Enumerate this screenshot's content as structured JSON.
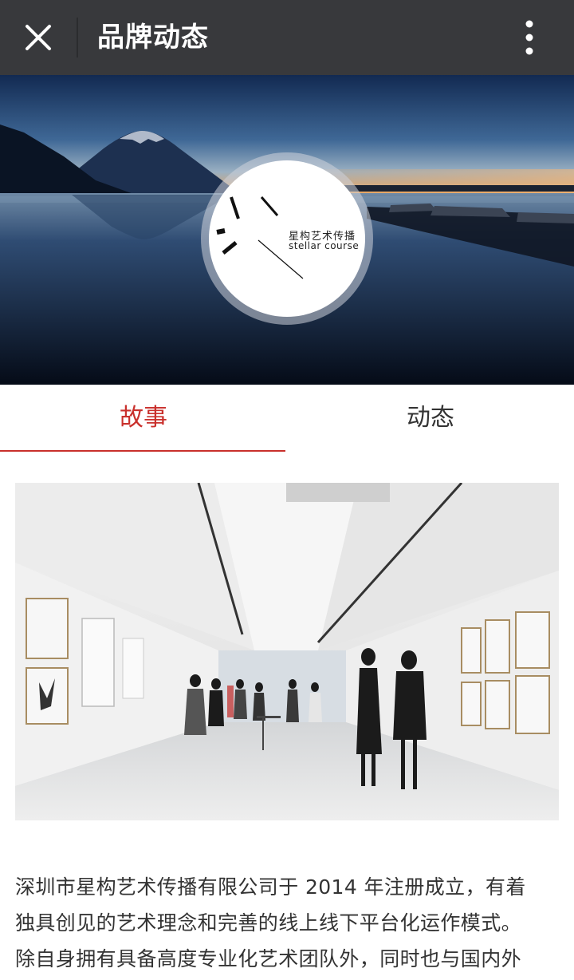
{
  "topbar": {
    "title": "品牌动态",
    "close_icon": "close-icon",
    "more_icon": "more-vertical-icon",
    "background": "#38393c"
  },
  "hero": {
    "image": "lake-mountain-dusk-photo",
    "logo": {
      "name_cn": "星构艺术传播",
      "name_en": "stellar course"
    }
  },
  "tabs": [
    {
      "label": "故事",
      "active": true
    },
    {
      "label": "动态",
      "active": false
    }
  ],
  "accent_color": "#c9302c",
  "article": {
    "photo": "art-gallery-exhibition-photo",
    "lines": [
      "深圳市星构艺术传播有限公司于 2014 年注册成立，有着",
      "独具创见的艺术理念和完善的线上线下平台化运作模式。",
      "除自身拥有具备高度专业化艺术团队外，同时也与国内外"
    ]
  }
}
